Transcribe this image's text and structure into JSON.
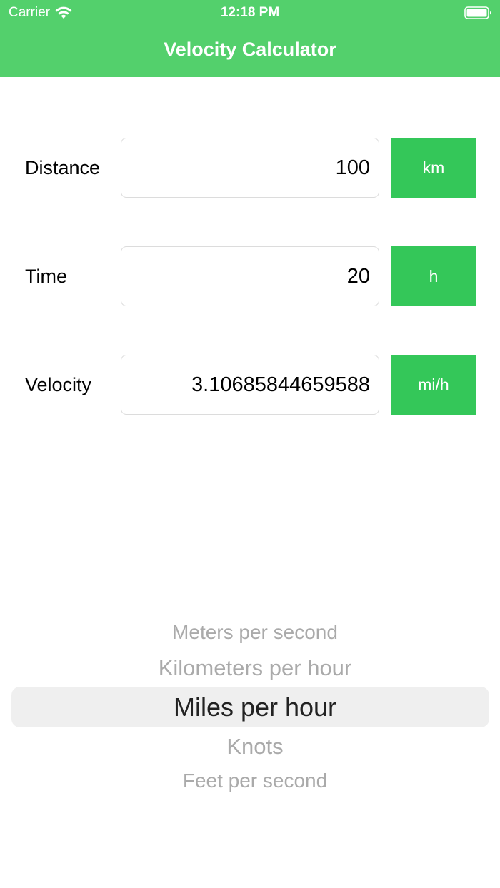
{
  "status_bar": {
    "carrier": "Carrier",
    "time": "12:18 PM"
  },
  "nav": {
    "title": "Velocity Calculator"
  },
  "rows": [
    {
      "label": "Distance",
      "value": "100",
      "unit": "km"
    },
    {
      "label": "Time",
      "value": "20",
      "unit": "h"
    },
    {
      "label": "Velocity",
      "value": "3.10685844659588",
      "unit": "mi/h"
    }
  ],
  "picker": {
    "options": [
      "Meters per second",
      "Kilometers per hour",
      "Miles per hour",
      "Knots",
      "Feet per second"
    ],
    "selected": "Miles per hour"
  },
  "colors": {
    "header_bg": "#53d06c",
    "button_bg": "#34c759",
    "picker_selection_bg": "#efefef"
  }
}
